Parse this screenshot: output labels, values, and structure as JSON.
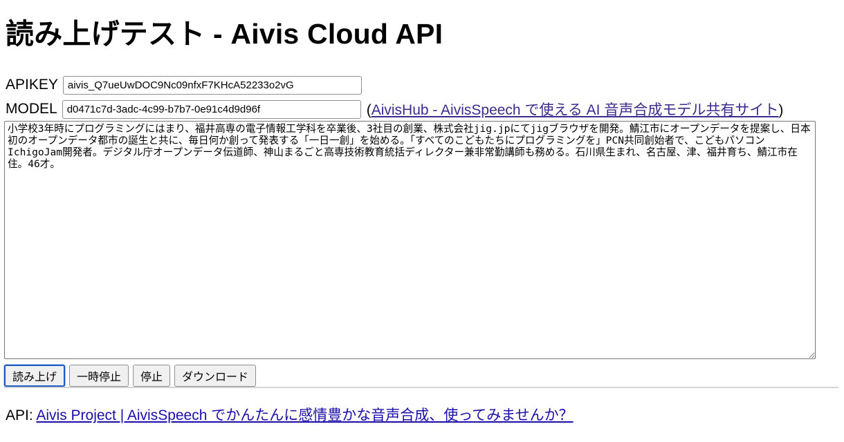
{
  "page": {
    "title": "読み上げテスト - Aivis Cloud API"
  },
  "form": {
    "apikey_label": "APIKEY",
    "apikey_value": "aivis_Q7ueUwDOC9Nc09nfxF7KHcA52233o2vG",
    "model_label": "MODEL",
    "model_value": "d0471c7d-3adc-4c99-b7b7-0e91c4d9d96f",
    "model_link_open": "(",
    "model_link_text": "AivisHub - AivisSpeech で使える AI 音声合成モデル共有サイト",
    "model_link_close": ")",
    "text_value": "小学校3年時にプログラミングにはまり、福井高専の電子情報工学科を卒業後、3社目の創業、株式会社jig.jpにてjigブラウザを開発。鯖江市にオープンデータを提案し、日本初のオープンデータ都市の誕生と共に、毎日何か創って発表する「一日一創」を始める。「すべてのこどもたちにプログラミングを」PCN共同創始者で、こどもパソコンIchigoJam開発者。デジタル庁オープンデータ伝道師、神山まるごと高専技術教育統括ディレクター兼非常勤講師も務める。石川県生まれ、名古屋、津、福井育ち、鯖江市在住。46才。"
  },
  "buttons": {
    "read": "読み上げ",
    "pause": "一時停止",
    "stop": "停止",
    "download": "ダウンロード"
  },
  "footer": {
    "prefix": "API: ",
    "link_text": "Aivis Project | AivisSpeech でかんたんに感情豊かな音声合成、使ってみませんか？"
  }
}
